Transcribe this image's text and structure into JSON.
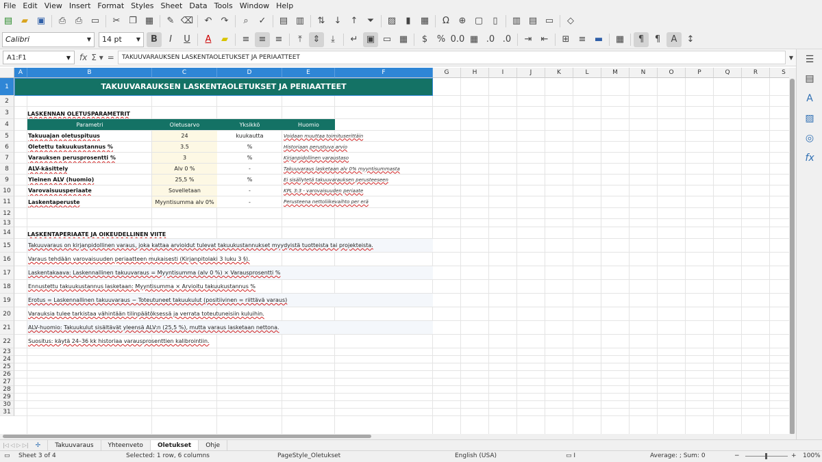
{
  "menu": [
    "File",
    "Edit",
    "View",
    "Insert",
    "Format",
    "Styles",
    "Sheet",
    "Data",
    "Tools",
    "Window",
    "Help"
  ],
  "toolbar": {
    "font_name": "Calibri",
    "font_size": "14 pt"
  },
  "formula_bar": {
    "name_box": "A1:F1",
    "content": "TAKUUVARAUKSEN LASKENTAOLETUKSET JA PERIAATTEET"
  },
  "columns": [
    "A",
    "B",
    "C",
    "D",
    "E",
    "F",
    "G",
    "H",
    "I",
    "J",
    "K",
    "L",
    "M",
    "N",
    "O",
    "P",
    "Q",
    "R",
    "S"
  ],
  "rows": [
    "1",
    "2",
    "3",
    "4",
    "5",
    "6",
    "7",
    "8",
    "9",
    "10",
    "11",
    "12",
    "13",
    "14",
    "15",
    "16",
    "17",
    "18",
    "19",
    "20",
    "21",
    "22",
    "23",
    "24",
    "25",
    "26",
    "27",
    "28",
    "29",
    "30",
    "31"
  ],
  "sheet": {
    "title": "TAKUUVARAUKSEN LASKENTAOLETUKSET JA PERIAATTEET",
    "section1": "LASKENNAN OLETUSPARAMETRIT",
    "headers": [
      "Parametri",
      "Oletusarvo",
      "Yksikkö",
      "Huomio"
    ],
    "params": [
      {
        "name": "Takuuajan oletuspituus",
        "value": "24",
        "unit": "kuukautta",
        "note": "Voidaan muuttaa toimituserittäin"
      },
      {
        "name": "Oletettu takuukustannus %",
        "value": "3.5",
        "unit": "%",
        "note": "Historiaan perustuva arvio"
      },
      {
        "name": "Varauksen perusprosentti %",
        "value": "3",
        "unit": "%",
        "note": "Kirjanpidollinen varaustaso"
      },
      {
        "name": "ALV-käsittely",
        "value": "Alv 0 %",
        "unit": "-",
        "note": "Takuuvaraus lasketaan alv 0% myyntisummasta"
      },
      {
        "name": "Yleinen ALV (huomio)",
        "value": "25,5 %",
        "unit": "%",
        "note": "Ei sisällytetä takuuvarauksen perusteeseen"
      },
      {
        "name": "Varovaisuusperiaate",
        "value": "Sovelletaan",
        "unit": "-",
        "note": "KPL 3:3 - varovaisuuden periaate"
      },
      {
        "name": "Laskentaperuste",
        "value": "Myyntisumma alv 0%",
        "unit": "-",
        "note": "Perusteena nettoliikevaihto per erä"
      }
    ],
    "section2": "LASKENTAPERIAATE JA OIKEUDELLINEN VIITE",
    "paragraphs": [
      "Takuuvaraus on kirjanpidollinen varaus, joka kattaa arvioidut tulevat takuukustannukset myydyistä tuotteista tai projekteista.",
      "Varaus tehdään varovaisuuden periaatteen mukaisesti (Kirjanpitolaki 3 luku 3 §).",
      "Laskentakaava: Laskennallinen takuuvaraus = Myyntisumma (alv 0 %) × Varausprosentti %",
      "Ennustettu takuukustannus lasketaan: Myyntisumma × Arvioitu takuukustannus %",
      "Erotus = Laskennallinen takuuvaraus − Toteutuneet takuukulut (positiivinen = riittävä varaus)",
      "Varauksia tulee tarkistaa vähintään tilinpäätöksessä ja verrata toteutuneisiin kuluihin.",
      "ALV-huomio: Takuukulut sisältävät yleensä ALV:n (25,5 %), mutta varaus lasketaan nettona.",
      "Suositus: käytä 24–36 kk historiaa varausprosenttien kalibrointiin."
    ]
  },
  "tabs": [
    "Takuuvaraus",
    "Yhteenveto",
    "Oletukset",
    "Ohje"
  ],
  "active_tab": "Oletukset",
  "status": {
    "sheet": "Sheet 3 of 4",
    "selection": "Selected: 1 row, 6 columns",
    "page_style": "PageStyle_Oletukset",
    "language": "English (USA)",
    "sum": "Average: ; Sum: 0",
    "zoom": "100%"
  }
}
